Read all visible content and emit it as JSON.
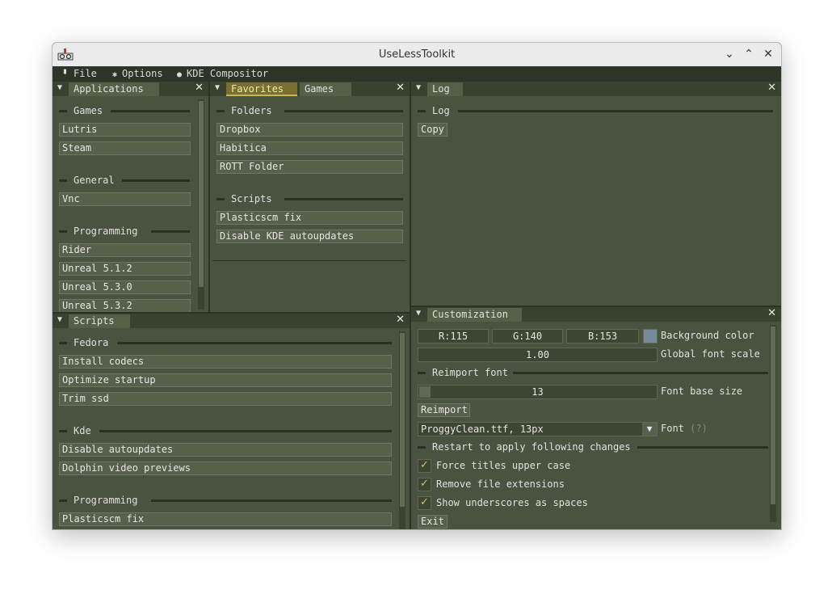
{
  "window": {
    "title": "UseLessToolkit"
  },
  "menubar": [
    {
      "icon": "file-icon",
      "label": "File"
    },
    {
      "icon": "gear-icon",
      "label": "Options"
    },
    {
      "icon": "toggle-icon",
      "label": "KDE Compositor"
    }
  ],
  "applications": {
    "tab": "Applications",
    "sections": [
      {
        "title": "Games",
        "items": [
          "Lutris",
          "Steam"
        ]
      },
      {
        "title": "General",
        "items": [
          "Vnc"
        ]
      },
      {
        "title": "Programming",
        "items": [
          "Rider",
          "Unreal 5.1.2",
          "Unreal 5.3.0",
          "Unreal 5.3.2"
        ]
      }
    ]
  },
  "favorites": {
    "tabs": [
      "Favorites",
      "Games"
    ],
    "sections": [
      {
        "title": "Folders",
        "items": [
          "Dropbox",
          "Habitica",
          "ROTT Folder"
        ]
      },
      {
        "title": "Scripts",
        "items": [
          "Plasticscm fix",
          "Disable KDE autoupdates"
        ]
      }
    ]
  },
  "log": {
    "tab": "Log",
    "section": "Log",
    "copy_label": "Copy"
  },
  "scripts": {
    "tab": "Scripts",
    "sections": [
      {
        "title": "Fedora",
        "items": [
          "Install codecs",
          "Optimize startup",
          "Trim ssd"
        ]
      },
      {
        "title": "Kde",
        "items": [
          "Disable autoupdates",
          "Dolphin video previews"
        ]
      },
      {
        "title": "Programming",
        "items": [
          "Plasticscm fix"
        ]
      }
    ]
  },
  "customization": {
    "tab": "Customization",
    "color": {
      "r": "R:115",
      "g": "G:140",
      "b": "B:153",
      "swatch": "#738c99",
      "label": "Background color"
    },
    "font_scale": {
      "value": "1.00",
      "label": "Global font scale"
    },
    "reimport_section": "Reimport font",
    "font_base": {
      "value": "13",
      "label": "Font base size"
    },
    "reimport_button": "Reimport",
    "font": {
      "value": "ProggyClean.ttf, 13px",
      "label": "Font",
      "help": "(?)"
    },
    "restart_section": "Restart to apply following changes",
    "checks": [
      "Force titles upper case",
      "Remove file extensions",
      "Show underscores as spaces"
    ],
    "exit_button": "Exit"
  }
}
